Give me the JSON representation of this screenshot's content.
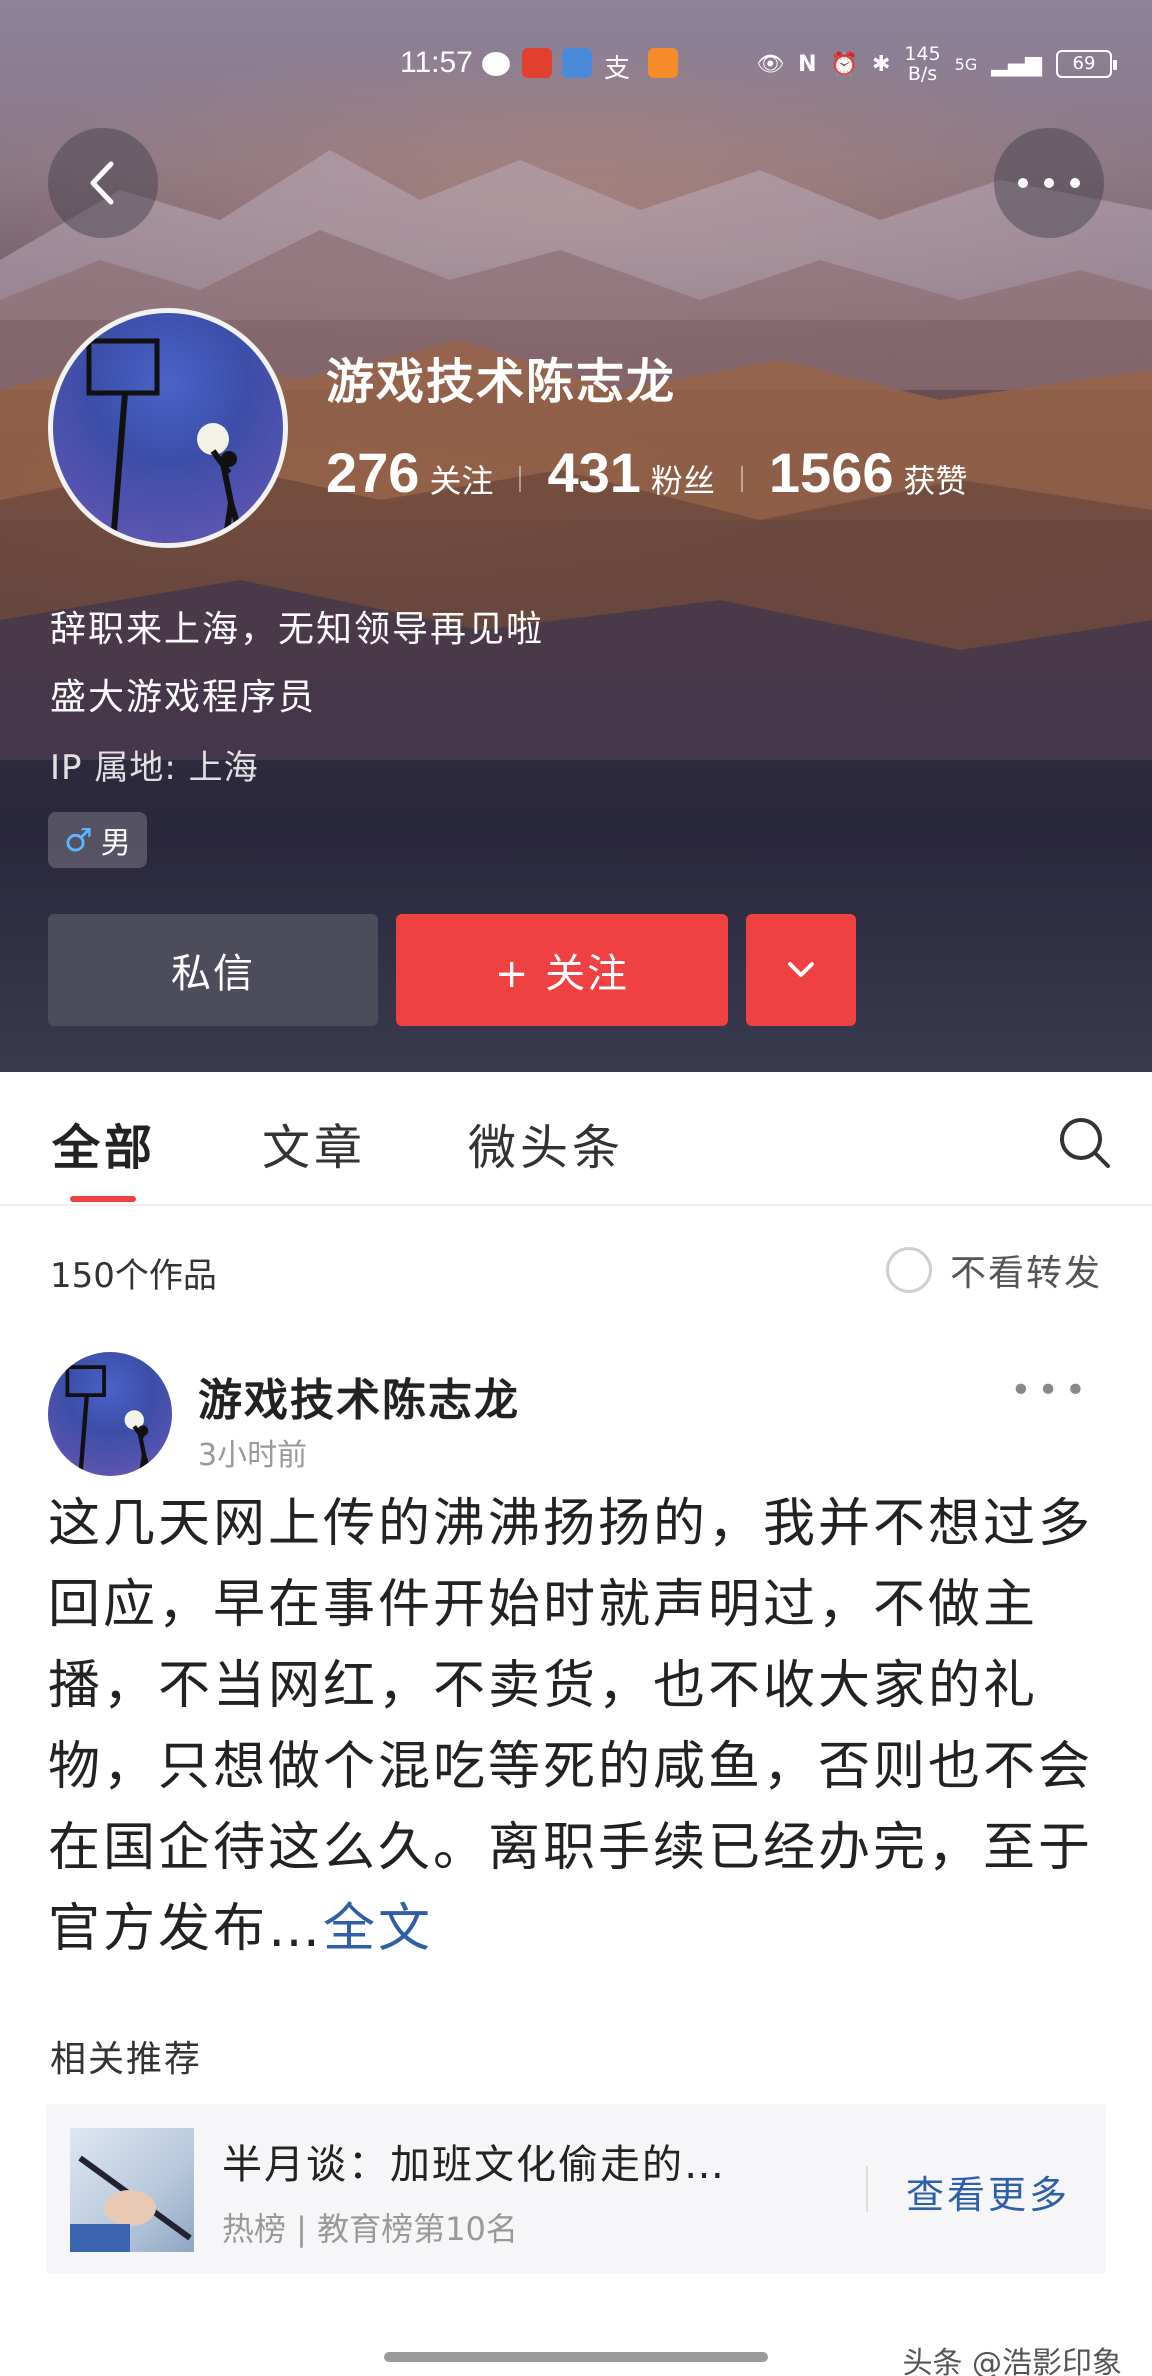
{
  "status_bar": {
    "time": "11:57",
    "net_speed_value": "145",
    "net_speed_unit": "B/s",
    "signal": "5G",
    "battery": "69"
  },
  "profile": {
    "name": "游戏技术陈志龙",
    "stats": [
      {
        "value": "276",
        "label": "关注"
      },
      {
        "value": "431",
        "label": "粉丝"
      },
      {
        "value": "1566",
        "label": "获赞"
      }
    ],
    "bio_line1": "辞职来上海，无知领导再见啦",
    "bio_line2": "盛大游戏程序员",
    "ip_location": "IP 属地: 上海",
    "gender": "男"
  },
  "actions": {
    "message_label": "私信",
    "follow_label": "+ 关注"
  },
  "tabs": [
    {
      "label": "全部"
    },
    {
      "label": "文章"
    },
    {
      "label": "微头条"
    }
  ],
  "works": {
    "count_label": "150个作品",
    "filter_label": "不看转发"
  },
  "post": {
    "author": "游戏技术陈志龙",
    "time": "3小时前",
    "text": "这几天网上传的沸沸扬扬的，我并不想过多回应，早在事件开始时就声明过，不做主播，不当网红，不卖货，也不收大家的礼物，只想做个混吃等死的咸鱼，否则也不会在国企待这么久。离职手续已经办完，至于官方发布…",
    "read_more": "全文"
  },
  "related": {
    "title": "相关推荐",
    "headline": "半月谈：加班文化偷走的…",
    "meta": "热榜 | 教育榜第10名",
    "more_label": "查看更多"
  },
  "watermark": "头条 @浩影印象",
  "colors": {
    "accent": "#f04142",
    "link": "#2f5fa8",
    "message_button": "#4c4c5a"
  }
}
